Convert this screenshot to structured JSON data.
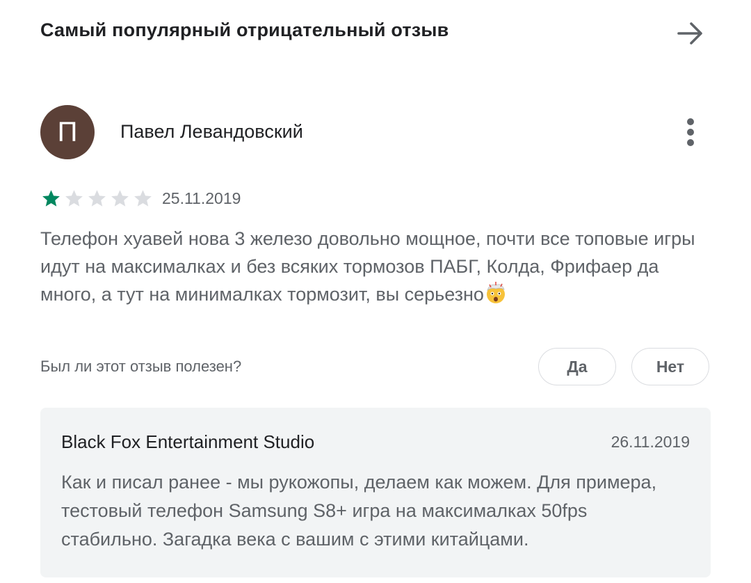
{
  "section": {
    "title": "Самый популярный отрицательный отзыв",
    "arrow_icon": "arrow-right-icon"
  },
  "review": {
    "avatar_letter": "П",
    "avatar_color": "#5b4037",
    "author": "Павел Левандовский",
    "menu_icon": "more-vert-icon",
    "rating": 1,
    "max_rating": 5,
    "star_color_filled": "#01875f",
    "star_color_empty": "#dadce0",
    "date": "25.11.2019",
    "text": "Телефон хуавей нова 3 железо довольно мощное, почти все топовые игры идут на максималках и без всяких тормозов ПАБГ, Колда, Фрифаер да много, а тут на минималках тормозит, вы серьезно",
    "emoji": "exploding-head-emoji"
  },
  "helpful": {
    "question": "Был ли этот отзыв полезен?",
    "yes_label": "Да",
    "no_label": "Нет"
  },
  "reply": {
    "developer": "Black Fox Entertainment Studio",
    "date": "26.11.2019",
    "text": "Как и писал ранее - мы рукожопы, делаем как можем. Для примера, тестовый телефон Samsung S8+ игра на максималках 50fps стабильно. Загадка века с вашим с этими китайцами."
  }
}
